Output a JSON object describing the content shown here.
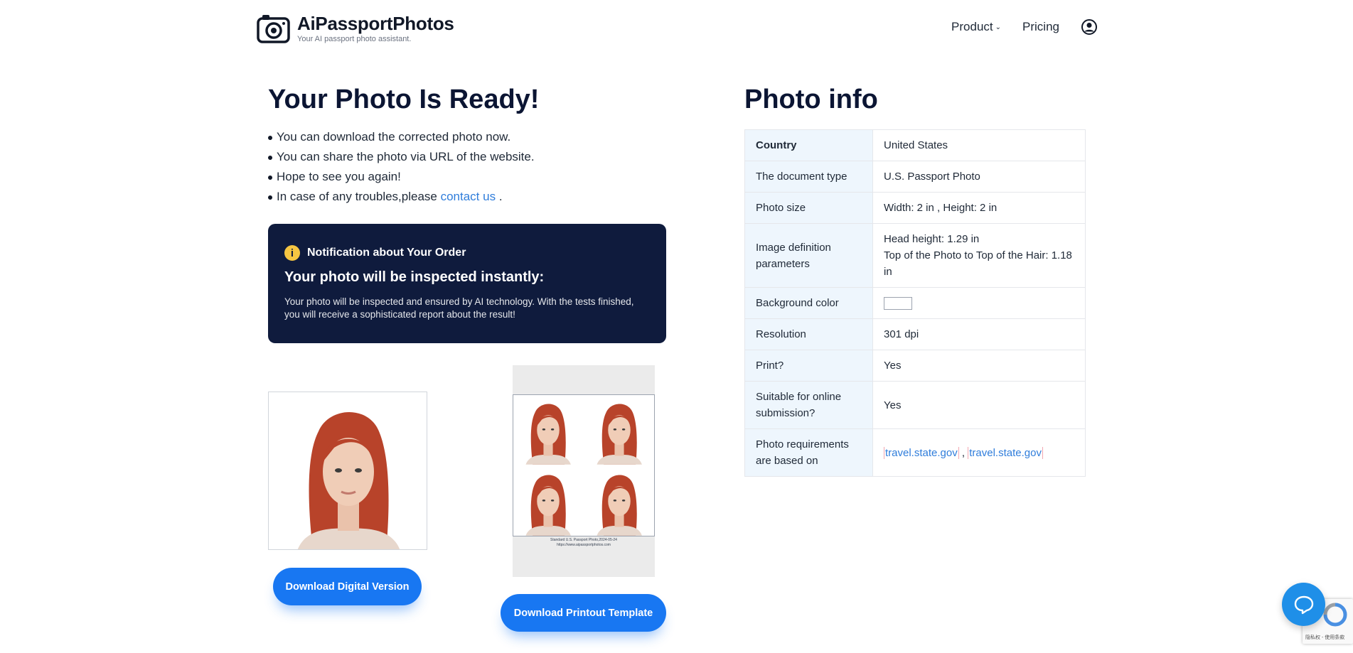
{
  "header": {
    "brand": "AiPassportPhotos",
    "tagline": "Your AI passport photo assistant.",
    "nav": [
      {
        "label": "Product",
        "has_dropdown": true
      },
      {
        "label": "Pricing",
        "has_dropdown": false
      }
    ]
  },
  "main": {
    "title": "Your Photo Is Ready!",
    "bullets": [
      "You can download the corrected photo now.",
      "You can share the photo via URL of the website.",
      "Hope to see you again!"
    ],
    "trouble_prefix": "In case of any troubles,please ",
    "trouble_link": "contact us",
    "trouble_suffix": " ."
  },
  "notification": {
    "title": "Notification about Your Order",
    "headline": "Your photo will be inspected instantly:",
    "body": "Your photo will be inspected and ensured by AI technology. With the tests finished, you will receive a sophisticated report about the result!"
  },
  "sheet": {
    "caption_line1": "Standard U.S. Passport Photo,2024-05-24",
    "caption_line2": "https://www.aipassportphotos.com"
  },
  "buttons": {
    "download_digital": "Download Digital Version",
    "download_printout": "Download Printout Template"
  },
  "photo_info": {
    "title": "Photo info",
    "rows": [
      {
        "key": "Country",
        "value": "United States"
      },
      {
        "key": "The document type",
        "value": "U.S. Passport Photo"
      },
      {
        "key": "Photo size",
        "value": "Width: 2 in , Height: 2 in"
      },
      {
        "key": "Image definition parameters",
        "value_line1": "Head height: 1.29 in",
        "value_line2": "Top of the Photo to Top of the Hair: 1.18 in"
      },
      {
        "key": "Background color",
        "swatch_color": "#ffffff"
      },
      {
        "key": "Resolution",
        "value": "301 dpi"
      },
      {
        "key": "Print?",
        "value": "Yes"
      },
      {
        "key": "Suitable for online submission?",
        "value": "Yes"
      },
      {
        "key": "Photo requirements are based on",
        "link1": "travel.state.gov",
        "separator": " , ",
        "link2": "travel.state.gov"
      }
    ]
  },
  "recaptcha": {
    "text": "隐私权 - 使用条款"
  },
  "colors": {
    "primary": "#1877f2",
    "notice_bg": "#0f1b3d",
    "link": "#2f7ddb",
    "table_key_bg": "#eef6fd",
    "hair": "#b8432a"
  },
  "icons": [
    "camera-logo-icon",
    "chevron-down-icon",
    "user-circle-icon",
    "info-icon",
    "chat-bubble-icon"
  ]
}
